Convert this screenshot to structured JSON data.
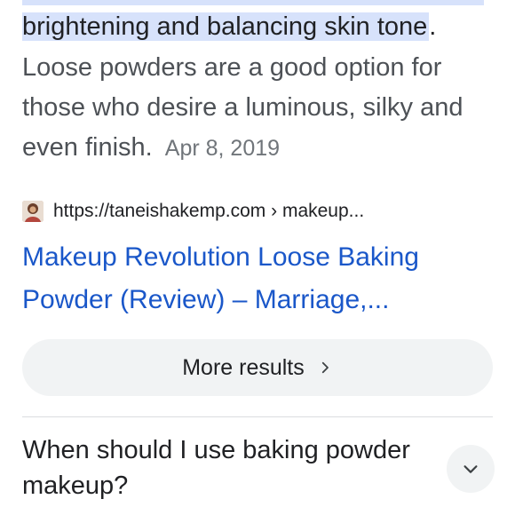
{
  "snippet": {
    "highlighted_text": "brightening and balancing skin tone",
    "highlight_trailing": ".",
    "body": "Loose powders are a good option for those who desire a luminous, silky and even finish.",
    "date": "Apr 8, 2019"
  },
  "result": {
    "favicon_icon": "site-favicon-icon",
    "url": "https://taneishakemp.com › makeup...",
    "title": "Makeup Revolution Loose Baking Powder (Review) – Marriage,..."
  },
  "more_results": {
    "label": "More results",
    "icon": "chevron-right-icon"
  },
  "faq": {
    "question": "When should I use baking powder makeup?",
    "expand_icon": "chevron-down-icon"
  },
  "colors": {
    "highlight": "#d7e2fb",
    "link": "#1a57c9",
    "text": "#202124",
    "muted": "#4d5156",
    "pill_bg": "#f1f3f4"
  }
}
